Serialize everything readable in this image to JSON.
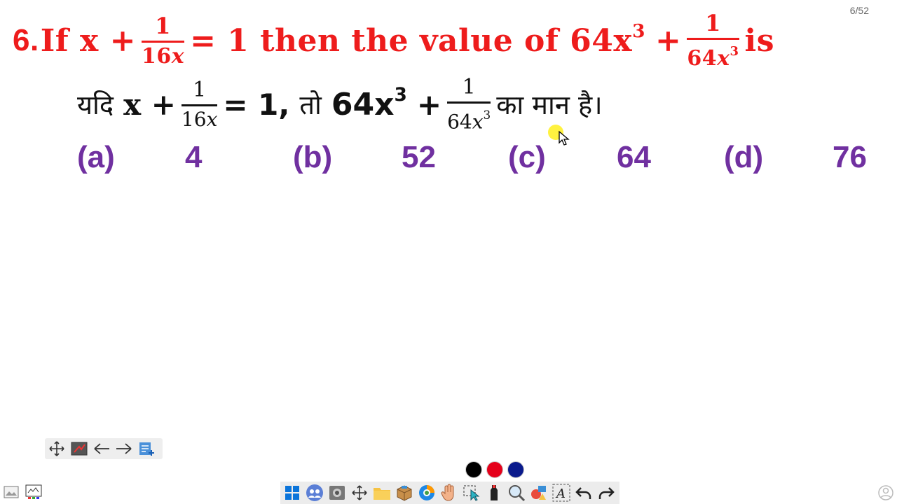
{
  "page_counter": "6/52",
  "question_en": {
    "number": "6.",
    "part1": "If x +",
    "frac1_num": "1",
    "frac1_den_num": "16",
    "frac1_den_var": "x",
    "part2": "= 1 then the value of 64x",
    "part2_sup": "3",
    "part3": "+",
    "frac2_num": "1",
    "frac2_den_num": "64",
    "frac2_den_var": "x",
    "frac2_den_sup": "3",
    "part4": "is"
  },
  "question_hi": {
    "yadi": "यदि",
    "x_plus": "x +",
    "frac1_num": "1",
    "frac1_den_num": "16",
    "frac1_den_var": "x",
    "eq": "= 1,",
    "to": "तो",
    "expr": "64x",
    "expr_sup": "3",
    "plus": "+",
    "frac2_num": "1",
    "frac2_den_num": "64",
    "frac2_den_var": "x",
    "frac2_den_sup": "3",
    "ending": "का मान है।"
  },
  "options": [
    {
      "label": "(a)",
      "value": "4"
    },
    {
      "label": "(b)",
      "value": "52"
    },
    {
      "label": "(c)",
      "value": "64"
    },
    {
      "label": "(d)",
      "value": "76"
    }
  ],
  "colors": {
    "question_en": "#ee1c1c",
    "options": "#7030a0",
    "pen_black": "#000000",
    "pen_red": "#e5001a",
    "pen_navy": "#0a1a8c"
  },
  "mini_toolbar_icons": [
    "move-icon",
    "whiteboard-icon",
    "arrow-left-icon",
    "arrow-right-icon",
    "new-page-icon"
  ],
  "taskbar_icons": [
    "windows-start-icon",
    "teams-icon",
    "screenshot-icon",
    "move-icon",
    "folder-icon",
    "package-icon",
    "browser-icon",
    "hand-icon",
    "select-icon",
    "marker-icon",
    "zoom-icon",
    "shapes-icon",
    "text-icon",
    "undo-icon",
    "redo-icon"
  ]
}
